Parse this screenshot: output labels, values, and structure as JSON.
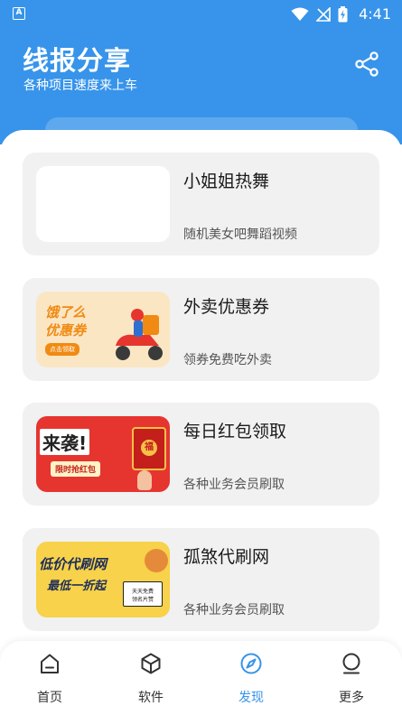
{
  "status_bar": {
    "time": "4:41"
  },
  "header": {
    "title": "线报分享",
    "subtitle": "各种项目速度来上车"
  },
  "cards": [
    {
      "title": "小姐姐热舞",
      "desc": "随机美女吧舞蹈视频",
      "thumb_text": []
    },
    {
      "title": "外卖优惠券",
      "desc": "领券免费吃外卖",
      "thumb_text": [
        "饿了么",
        "优惠券",
        "点击领取"
      ]
    },
    {
      "title": "每日红包领取",
      "desc": "各种业务会员刷取",
      "thumb_text": [
        "来袭!",
        "限时抢红包",
        "福"
      ]
    },
    {
      "title": "孤煞代刷网",
      "desc": "各种业务会员刷取",
      "thumb_text": [
        "低价代刷网",
        "最低一折起",
        "天天免费",
        "领名片赞"
      ]
    }
  ],
  "nav": [
    {
      "label": "首页",
      "icon": "home-icon",
      "active": false
    },
    {
      "label": "软件",
      "icon": "cube-icon",
      "active": false
    },
    {
      "label": "发现",
      "icon": "compass-icon",
      "active": true
    },
    {
      "label": "更多",
      "icon": "user-icon",
      "active": false
    }
  ],
  "colors": {
    "primary": "#3794ea",
    "card_bg": "#f1f1f1",
    "red": "#e6352f"
  }
}
